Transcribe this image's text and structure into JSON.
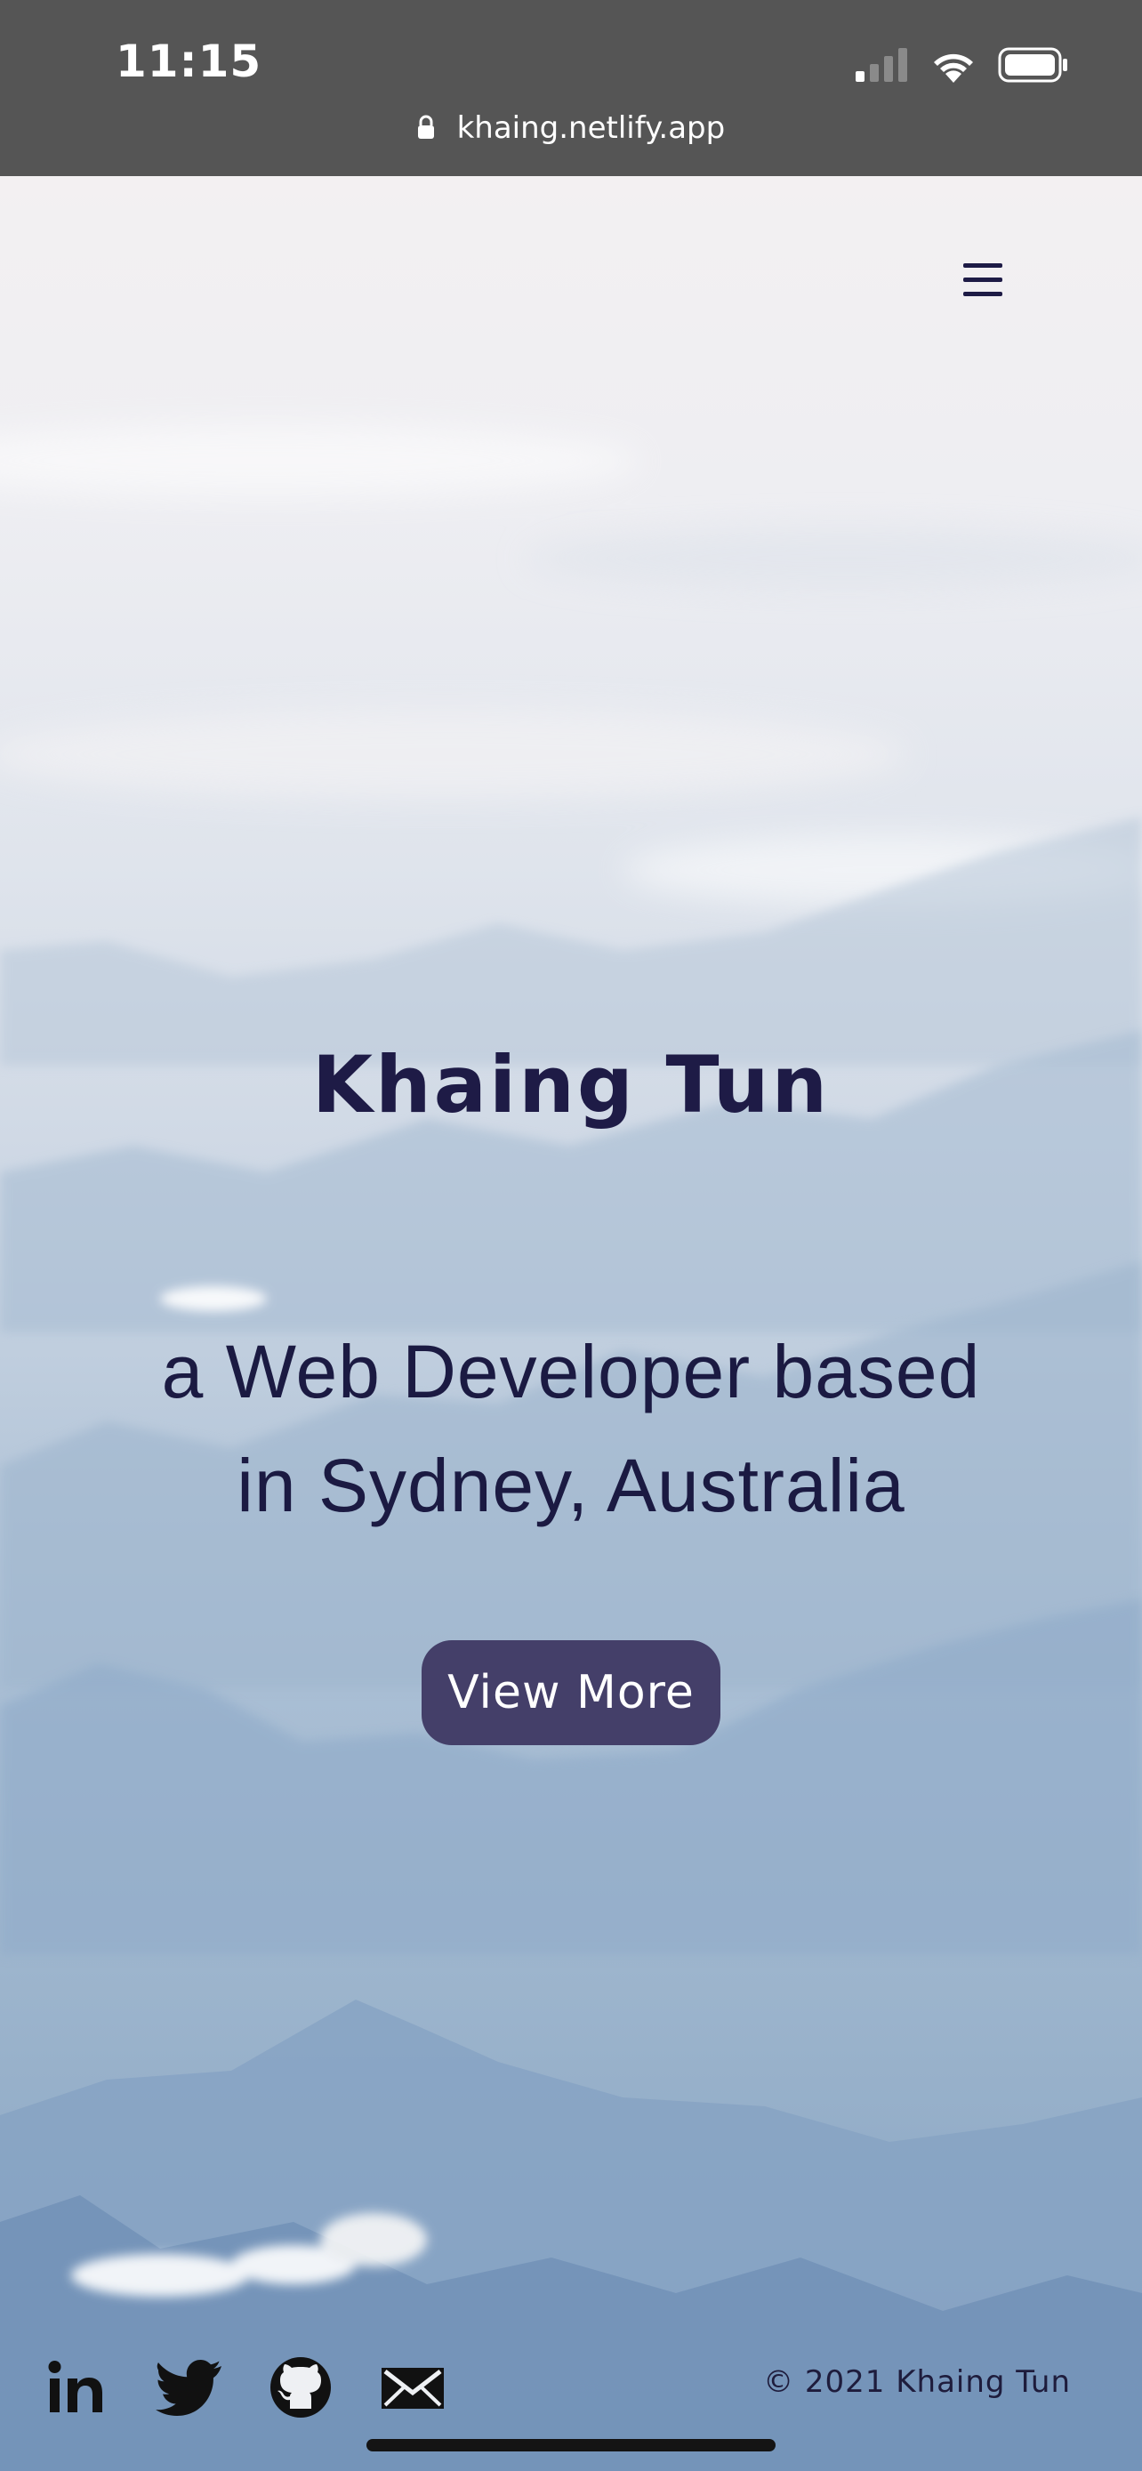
{
  "status_bar": {
    "time": "11:15",
    "url": "khaing.netlify.app",
    "icons": [
      "cellular-signal-icon",
      "wifi-icon",
      "battery-icon",
      "lock-icon"
    ]
  },
  "header": {
    "menu_icon": "hamburger-menu-icon"
  },
  "hero": {
    "name": "Khaing Tun",
    "tagline_line1": "a Web Developer based",
    "tagline_line2": "in Sydney, Australia",
    "cta_label": "View More",
    "cta_color": "#443f69",
    "text_color": "#1e1b46"
  },
  "footer": {
    "social_links": [
      "linkedin-icon",
      "twitter-icon",
      "github-icon",
      "email-icon"
    ],
    "copyright": "© 2021 Khaing Tun"
  }
}
